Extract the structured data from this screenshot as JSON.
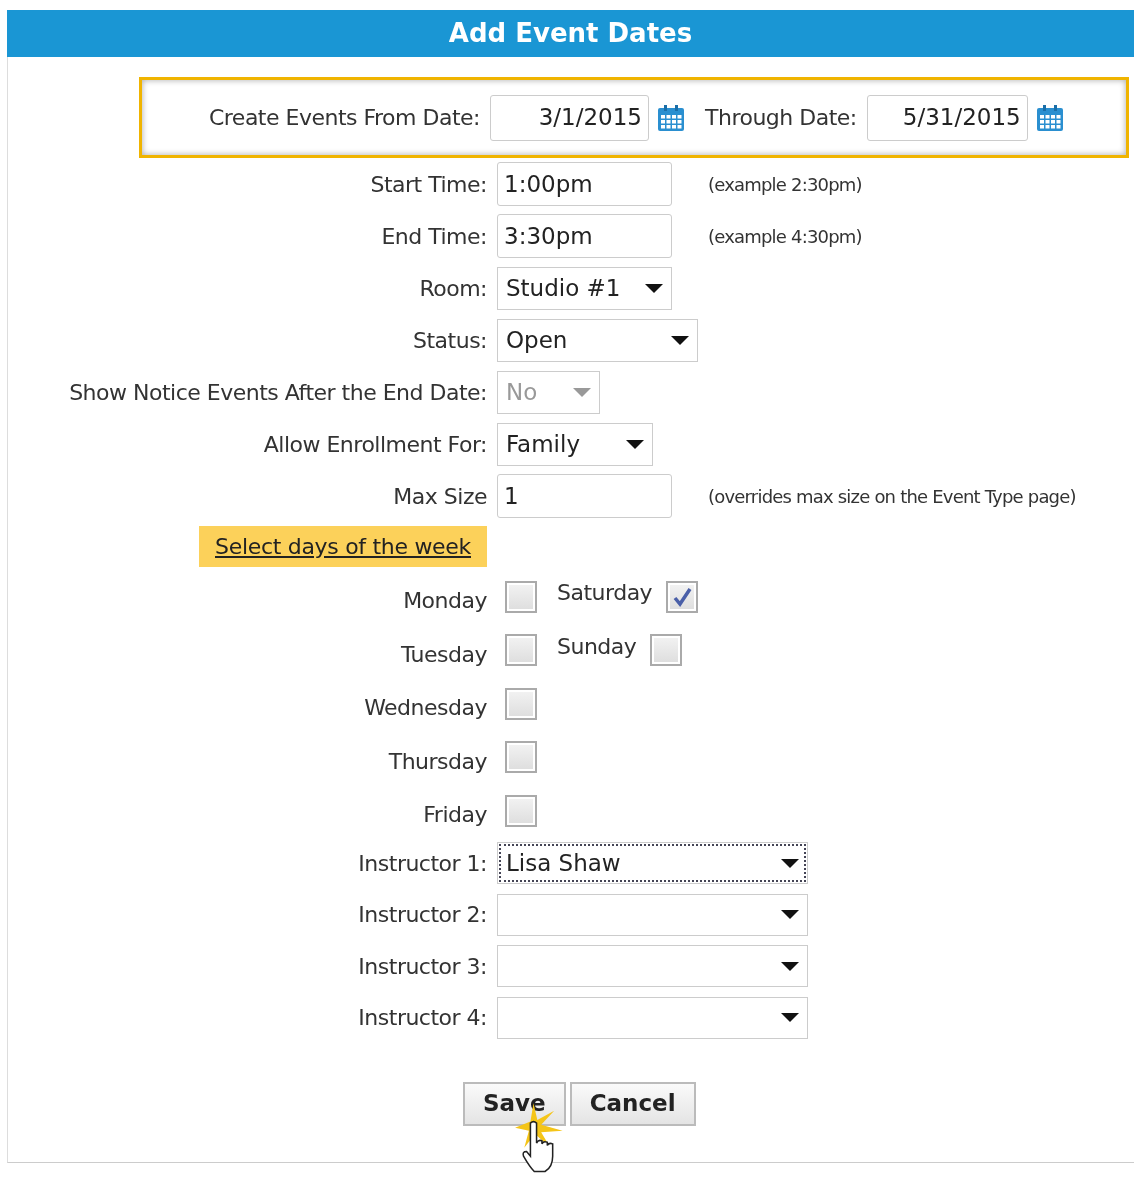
{
  "title": "Add Event Dates",
  "date_range": {
    "highlighted": true,
    "from": {
      "label": "Create Events From Date:",
      "value": "3/1/2015"
    },
    "through": {
      "label": "Through Date:",
      "value": "5/31/2015"
    }
  },
  "fields": [
    {
      "kind": "text",
      "label": "Start Time:",
      "value": "1:00pm",
      "hint": "(example 2:30pm)"
    },
    {
      "kind": "text",
      "label": "End Time:",
      "value": "3:30pm",
      "hint": "(example 4:30pm)"
    },
    {
      "kind": "select",
      "label": "Room:",
      "value": "Studio #1",
      "disabled": false
    },
    {
      "kind": "select",
      "label": "Status:",
      "value": "Open",
      "disabled": false
    },
    {
      "kind": "select",
      "label": "Show Notice Events After the End Date:",
      "value": "No",
      "disabled": true
    },
    {
      "kind": "select",
      "label": "Allow Enrollment For:",
      "value": "Family",
      "disabled": false
    },
    {
      "kind": "text",
      "label": "Max Size",
      "value": "1",
      "hint": "(overrides max size on the Event Type page)"
    }
  ],
  "days_link": {
    "label": "Select days of the week",
    "highlighted": true
  },
  "day_rows": [
    {
      "left": {
        "label": "Monday",
        "checked": false
      },
      "right": {
        "label": "Saturday",
        "checked": true
      }
    },
    {
      "left": {
        "label": "Tuesday",
        "checked": false
      },
      "right": {
        "label": "Sunday",
        "checked": false
      }
    },
    {
      "left": {
        "label": "Wednesday",
        "checked": false
      }
    },
    {
      "left": {
        "label": "Thursday",
        "checked": false
      }
    },
    {
      "left": {
        "label": "Friday",
        "checked": false
      }
    }
  ],
  "instructors": [
    {
      "label": "Instructor 1:",
      "value": "Lisa Shaw",
      "focused": true
    },
    {
      "label": "Instructor 2:",
      "focused": false
    },
    {
      "label": "Instructor 3:",
      "focused": false
    },
    {
      "label": "Instructor 4:",
      "focused": false
    }
  ],
  "buttons": [
    {
      "label": "Save",
      "cursor": true
    },
    {
      "label": "Cancel",
      "cursor": false
    }
  ]
}
